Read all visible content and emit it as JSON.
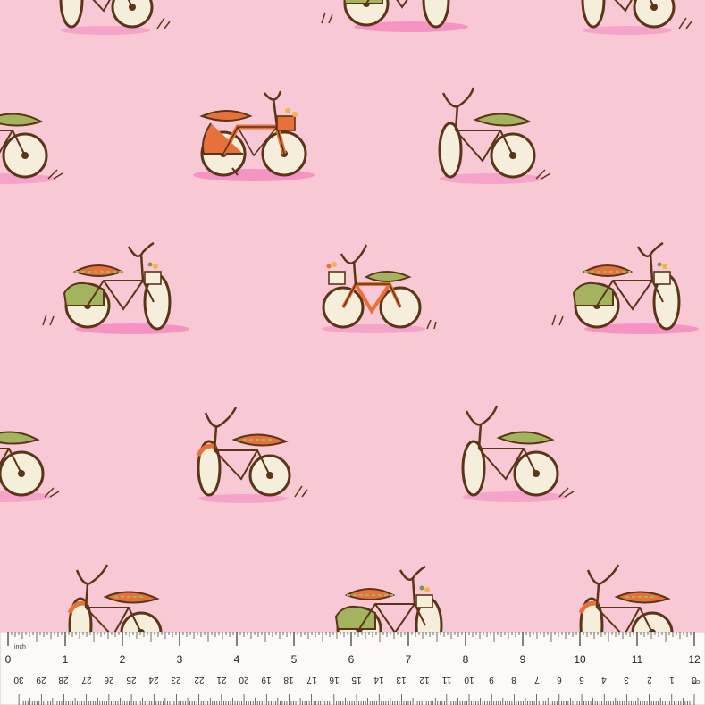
{
  "fabric": {
    "background_color": "#f8c8d4",
    "motif": "bicycle-illustration",
    "palette": {
      "outline": "#5a3518",
      "orange": "#e8703a",
      "green": "#a3b35e",
      "cream": "#f4eedb",
      "shadow": "#f48bbf",
      "leaf": "#7d9a4a",
      "flower": "#f3b24b"
    }
  },
  "ruler": {
    "color": "#fbfaf7",
    "inch_unit_label": "inch",
    "cm_unit_label": "cm",
    "inch_labels": [
      "0",
      "1",
      "2",
      "3",
      "4",
      "5",
      "6",
      "7",
      "8",
      "9",
      "10",
      "11",
      "12"
    ],
    "cm_labels": [
      "30",
      "29",
      "28",
      "27",
      "26",
      "25",
      "24",
      "23",
      "22",
      "21",
      "20",
      "19",
      "18",
      "17",
      "16",
      "15",
      "14",
      "13",
      "12",
      "11",
      "10",
      "9",
      "8",
      "7",
      "6",
      "5",
      "4",
      "3",
      "2",
      "1",
      "0"
    ]
  }
}
